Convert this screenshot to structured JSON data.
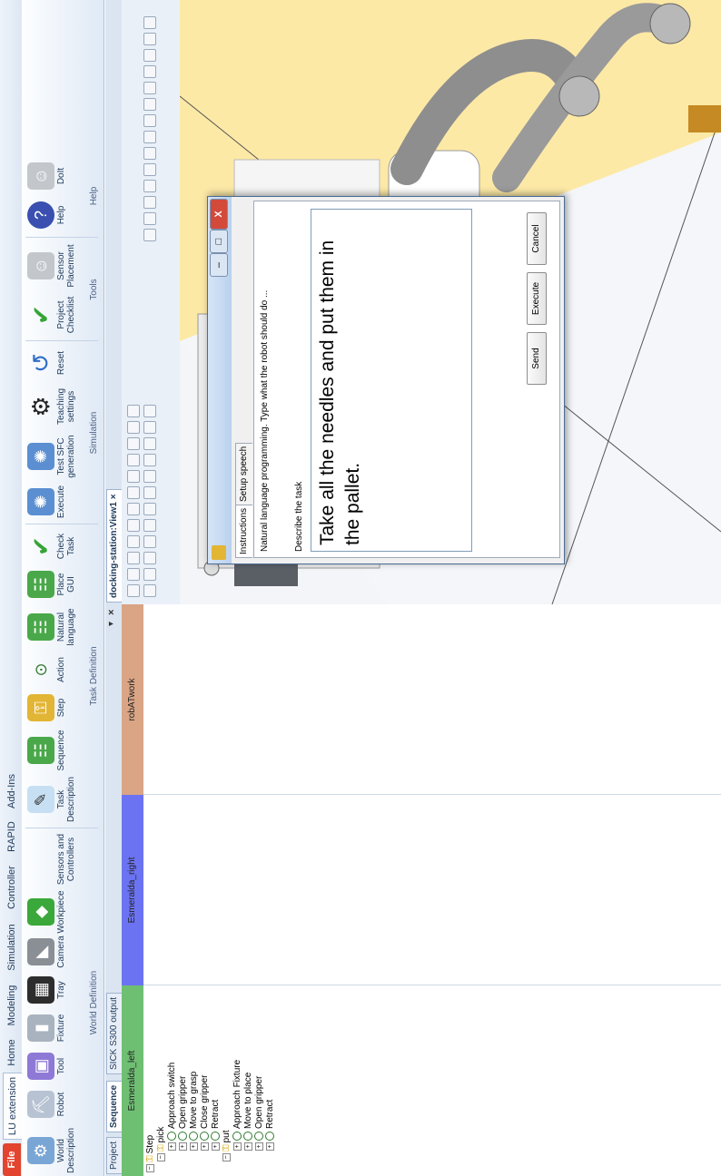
{
  "ribbon": {
    "tabs": [
      "File",
      "LU extension",
      "Home",
      "Modeling",
      "Simulation",
      "Controller",
      "RAPID",
      "Add-Ins"
    ],
    "groups": {
      "world_definition": {
        "label": "World Definition",
        "buttons": [
          "World Description",
          "Robot",
          "Tool",
          "Fixture",
          "Tray",
          "Camera",
          "Workpiece",
          "Sensors and Controllers"
        ]
      },
      "task_definition": {
        "label": "Task Definition",
        "buttons": [
          "Task Description",
          "Sequence",
          "Step",
          "Action",
          "Natural language",
          "Place GUI",
          "Check Task"
        ]
      },
      "simulation": {
        "label": "Simulation",
        "buttons": [
          "Execute",
          "Test SFC generation",
          "Teaching settings",
          "Reset"
        ]
      },
      "tools": {
        "label": "Tools",
        "buttons": [
          "Project Checklist",
          "Sensor Placement"
        ]
      },
      "help": {
        "label": "Help",
        "buttons": [
          "Help",
          "DoIt"
        ]
      }
    }
  },
  "left_panel": {
    "tabs": [
      "Project",
      "Sequence",
      "SICK S300 output"
    ],
    "lanes": [
      "Esmeralda_left",
      "Esmeralda_right",
      "robATwork"
    ],
    "lane_colors": [
      "#6fbf73",
      "#6b73f2",
      "#d9a585"
    ],
    "tree": [
      {
        "label": "Step",
        "level": 0
      },
      {
        "label": "pick",
        "level": 1
      },
      {
        "label": "Approach switch",
        "level": 2
      },
      {
        "label": "Open gripper",
        "level": 2
      },
      {
        "label": "Move to grasp",
        "level": 2
      },
      {
        "label": "Close gripper",
        "level": 2
      },
      {
        "label": "Retract",
        "level": 2
      },
      {
        "label": "put",
        "level": 1
      },
      {
        "label": "Approach Fixture",
        "level": 2
      },
      {
        "label": "Move to place",
        "level": 2
      },
      {
        "label": "Open gripper",
        "level": 2
      },
      {
        "label": "Retract",
        "level": 2
      }
    ]
  },
  "view": {
    "tab_label": "docking-station:View1"
  },
  "dialog": {
    "tabs": [
      "Instructions",
      "Setup speech"
    ],
    "intro": "Natural language programming. Type what the robot should do ...",
    "describe_label": "Describe the task",
    "task_text": "Take all the needles and put them in the pallet.",
    "buttons": {
      "send": "Send",
      "execute": "Execute",
      "cancel": "Cancel"
    },
    "title_controls": [
      "–",
      "□",
      "X"
    ]
  }
}
